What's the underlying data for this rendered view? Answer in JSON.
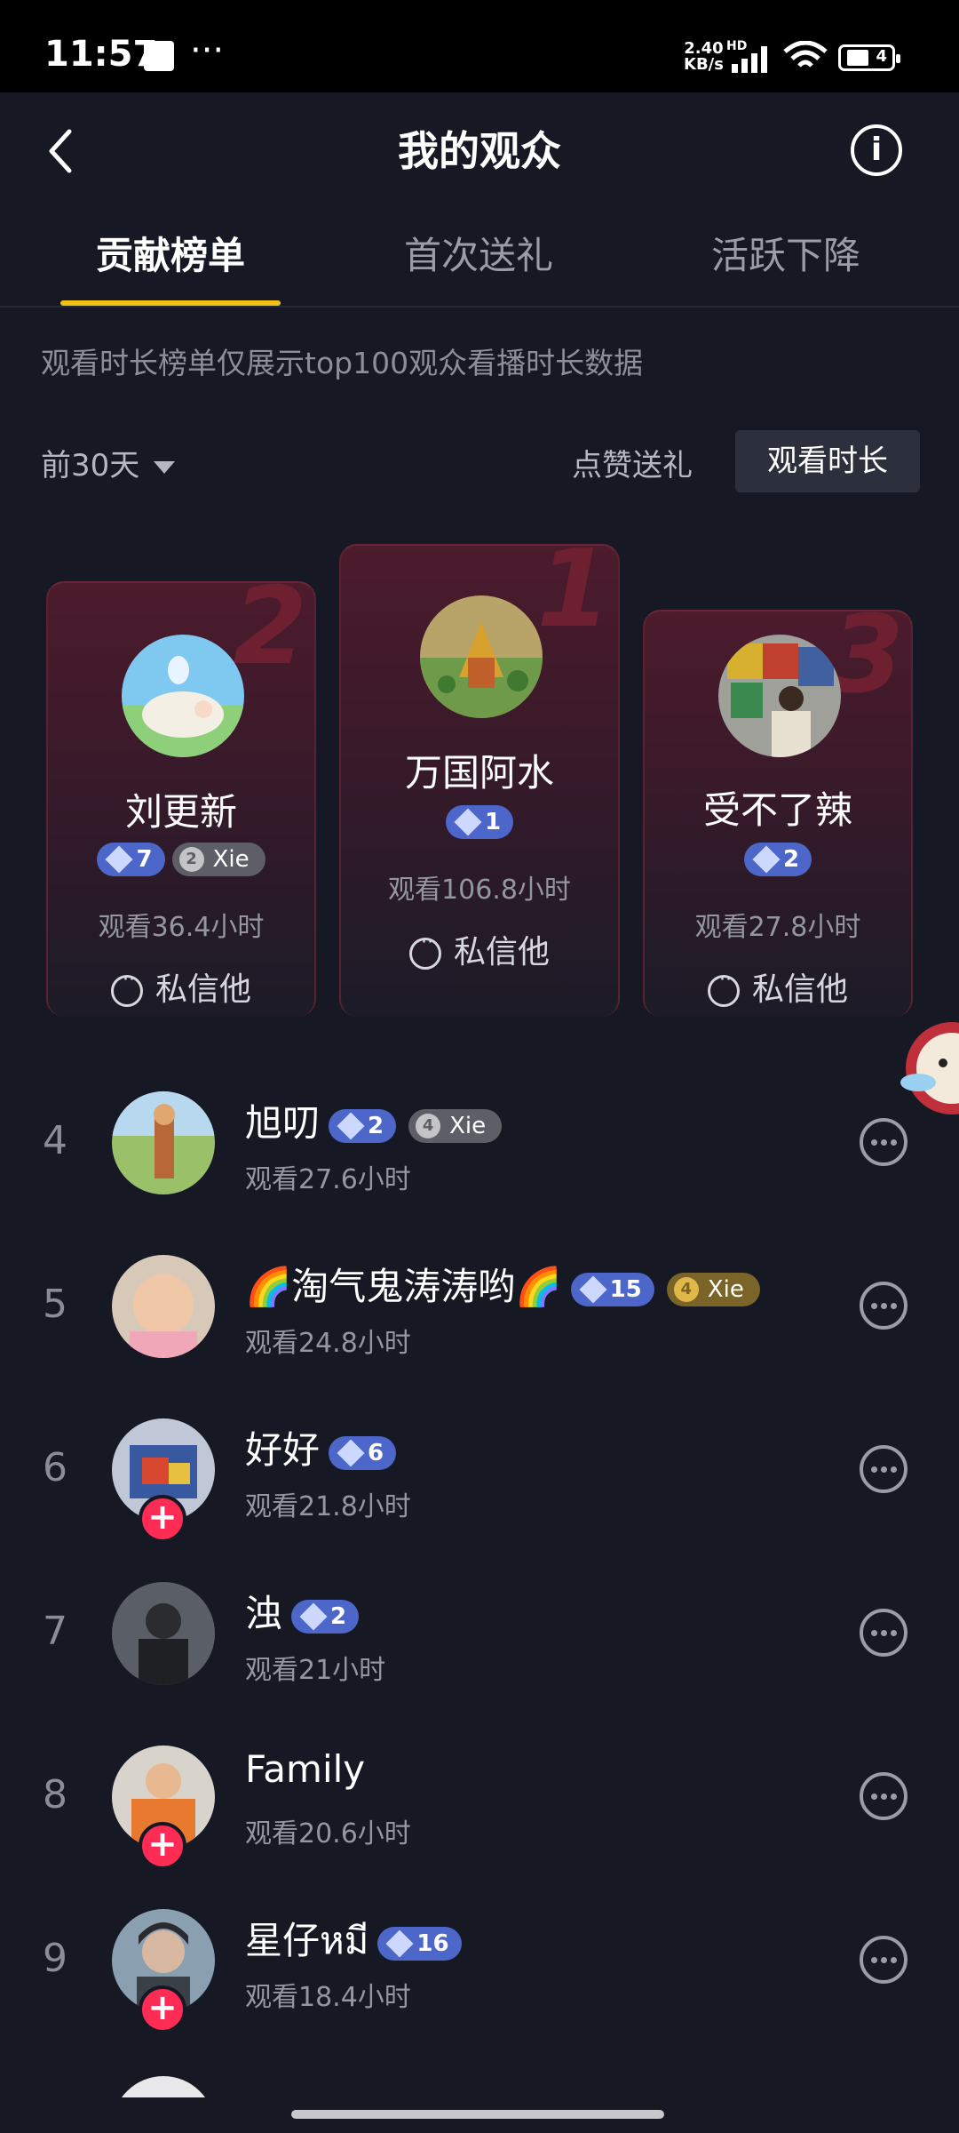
{
  "status_bar": {
    "time": "11:57",
    "net_speed": "2.40",
    "net_unit": "KB/s",
    "hd": "HD",
    "battery": "4"
  },
  "header": {
    "title": "我的观众"
  },
  "tabs": [
    {
      "label": "贡献榜单",
      "active": true
    },
    {
      "label": "首次送礼",
      "active": false
    },
    {
      "label": "活跃下降",
      "active": false
    }
  ],
  "notice": "观看时长榜单仅展示top100观众看播时长数据",
  "filter": {
    "period": "前30天",
    "sort_options": [
      "点赞送礼",
      "观看时长"
    ],
    "selected": "观看时长"
  },
  "podium": [
    {
      "rank": "1",
      "name": "万国阿水",
      "level": "1",
      "watch": "观看106.8小时",
      "message": "私信他"
    },
    {
      "rank": "2",
      "name": "刘更新",
      "level": "7",
      "fan_level": "2",
      "fan_club": "Xie",
      "watch": "观看36.4小时",
      "message": "私信他"
    },
    {
      "rank": "3",
      "name": "受不了辣",
      "level": "2",
      "watch": "观看27.8小时",
      "message": "私信他"
    }
  ],
  "list": [
    {
      "rank": "4",
      "name": "旭叨",
      "level": "2",
      "fan_level": "4",
      "fan_club": "Xie",
      "watch": "观看27.6小时"
    },
    {
      "rank": "5",
      "name": "🌈淘气鬼涛涛哟🌈",
      "level": "15",
      "fan_level": "4",
      "fan_club": "Xie",
      "watch": "观看24.8小时"
    },
    {
      "rank": "6",
      "name": "好好",
      "level": "6",
      "watch": "观看21.8小时"
    },
    {
      "rank": "7",
      "name": "浊",
      "level": "2",
      "watch": "观看21小时"
    },
    {
      "rank": "8",
      "name": "Family",
      "watch": "观看20.6小时"
    },
    {
      "rank": "9",
      "name": "星仔หมี",
      "level": "16",
      "watch": "观看18.4小时"
    }
  ],
  "colors": {
    "background": "#161824",
    "accent": "#f2c015",
    "follow": "#fe2c55",
    "level_badge": "#4d66c9"
  }
}
